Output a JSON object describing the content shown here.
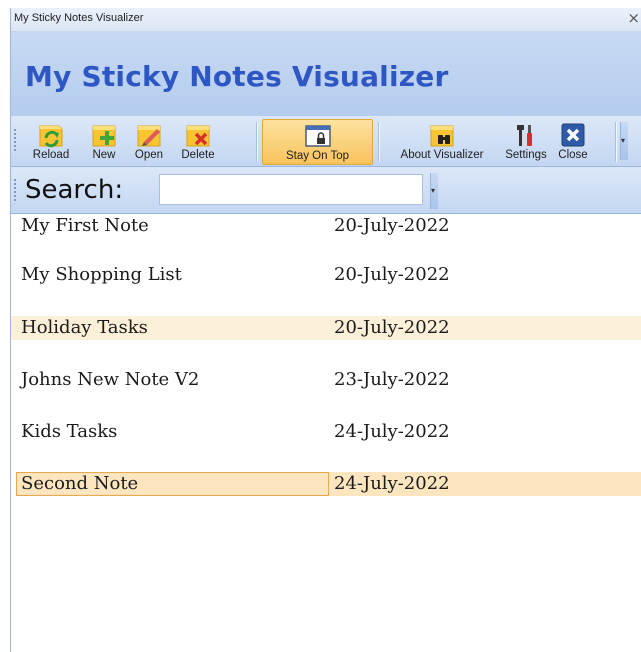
{
  "window": {
    "title": "My Sticky Notes Visualizer",
    "close_glyph": "×"
  },
  "banner": {
    "title": "My Sticky Notes Visualizer"
  },
  "toolbar": {
    "reload_label": "Reload",
    "new_label": "New",
    "open_label": "Open",
    "delete_label": "Delete",
    "stay_on_top_label": "Stay On Top",
    "about_label": "About Visualizer",
    "settings_label": "Settings",
    "close_label": "Close",
    "overflow_glyph": "▾"
  },
  "search": {
    "label": "Search:",
    "value": "",
    "overflow_glyph": "▾"
  },
  "notes": [
    {
      "name": "My First Note",
      "date": "20-July-2022"
    },
    {
      "name": "My Shopping List",
      "date": "20-July-2022"
    },
    {
      "name": "Holiday Tasks",
      "date": "20-July-2022"
    },
    {
      "name": "Johns New Note V2",
      "date": "23-July-2022"
    },
    {
      "name": "Kids Tasks",
      "date": "24-July-2022"
    },
    {
      "name": "Second Note",
      "date": "24-July-2022"
    }
  ],
  "icons": {
    "reload": "reload-icon",
    "new": "new-note-icon",
    "open": "open-note-icon",
    "delete": "delete-note-icon",
    "stay_on_top": "window-lock-icon",
    "about": "binoculars-note-icon",
    "settings": "tools-icon",
    "close": "close-box-icon"
  },
  "colors": {
    "note_yellow": "#f7c531",
    "accent_blue": "#2f57c4",
    "active_orange": "#f9c35c",
    "row_alt": "#fdf0d8",
    "delete_red": "#d9302b",
    "reload_green": "#2f9a3a"
  }
}
